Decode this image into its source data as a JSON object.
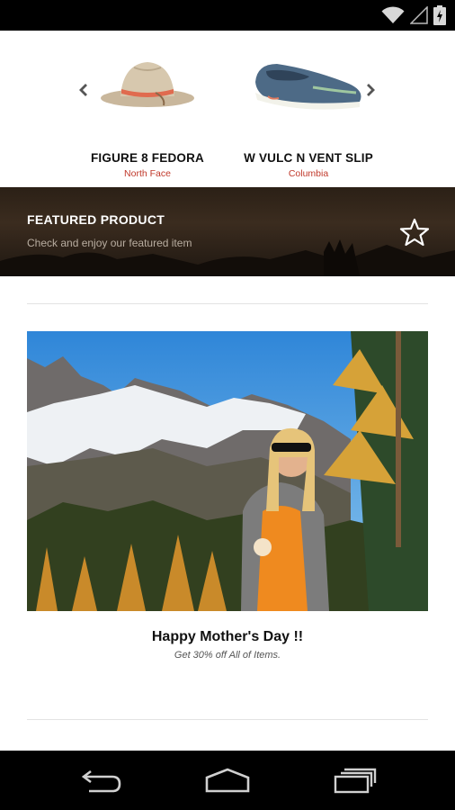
{
  "carousel": {
    "products": [
      {
        "name": "FIGURE 8 FEDORA",
        "brand": "North Face",
        "icon": "fedora-hat-image"
      },
      {
        "name": "W VULC N VENT SLIP",
        "brand": "Columbia",
        "icon": "slip-on-shoe-image"
      }
    ]
  },
  "featured": {
    "title": "FEATURED PRODUCT",
    "subtitle": "Check and enjoy our featured item",
    "icon": "star-icon"
  },
  "promo": {
    "title": "Happy Mother's Day !!",
    "subtitle": "Get 30% off All of Items."
  },
  "colors": {
    "brand_text": "#c0392b",
    "status_bar": "#000000",
    "nav_bar": "#000000"
  }
}
